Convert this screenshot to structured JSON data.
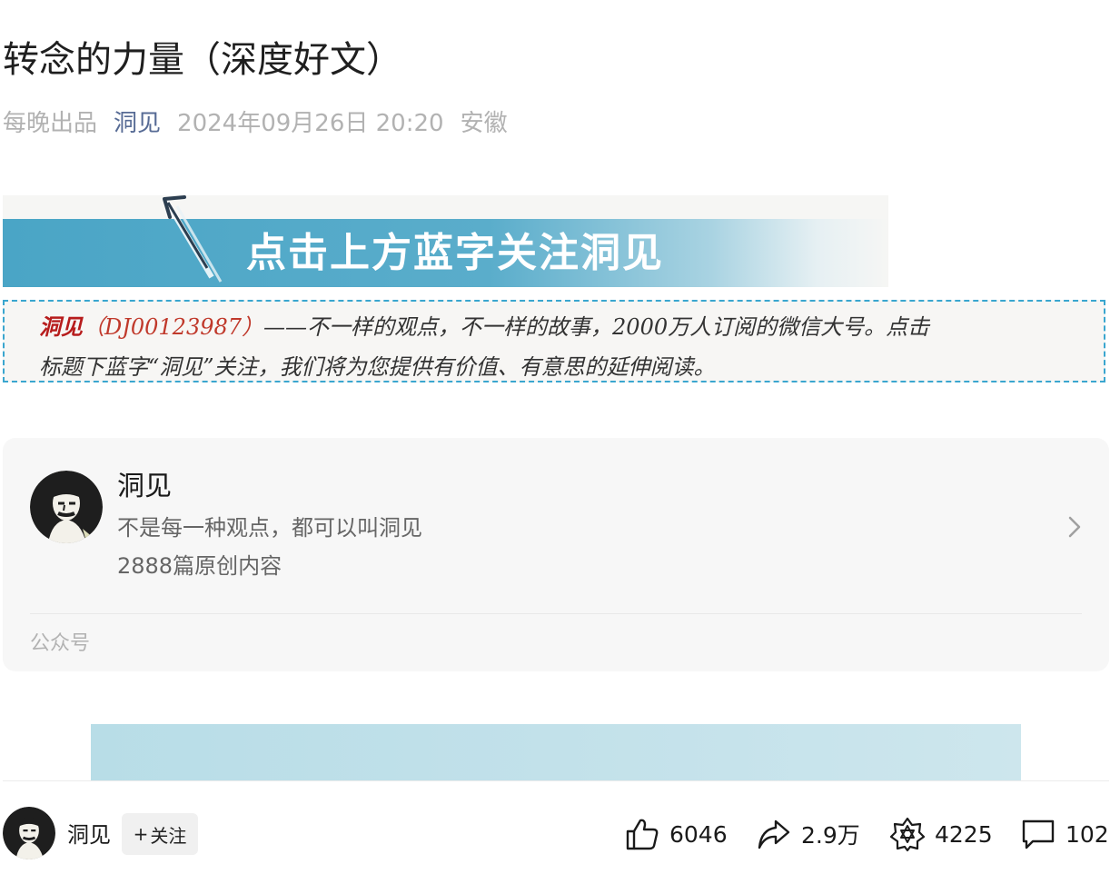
{
  "article": {
    "title": "转念的力量（深度好文）",
    "meta": {
      "prefix": "每晚出品",
      "author": "洞见",
      "datetime": "2024年09月26日 20:20",
      "location": "安徽"
    }
  },
  "banner": {
    "text": "点击上方蓝字关注洞见"
  },
  "intro": {
    "name": "洞见",
    "account_id": "（DJ00123987）",
    "line1_rest": "——不一样的观点，不一样的故事，2000万人订阅的微信大号。点击",
    "line2": "标题下蓝字“洞见”关注，我们将为您提供有价值、有意思的延伸阅读。"
  },
  "account_card": {
    "name": "洞见",
    "slogan": "不是每一种观点，都可以叫洞见",
    "original_count": "2888篇原创内容",
    "type_label": "公众号"
  },
  "bottom_bar": {
    "author": "洞见",
    "follow_label": "关注",
    "follow_plus": "+",
    "likes": "6046",
    "shares": "2.9万",
    "wow": "4225",
    "comments": "102"
  },
  "colors": {
    "link": "#576b95",
    "intro_border": "#3aa6cf",
    "intro_red": "#b71c1c",
    "banner_blue": "#4aa5c6"
  }
}
